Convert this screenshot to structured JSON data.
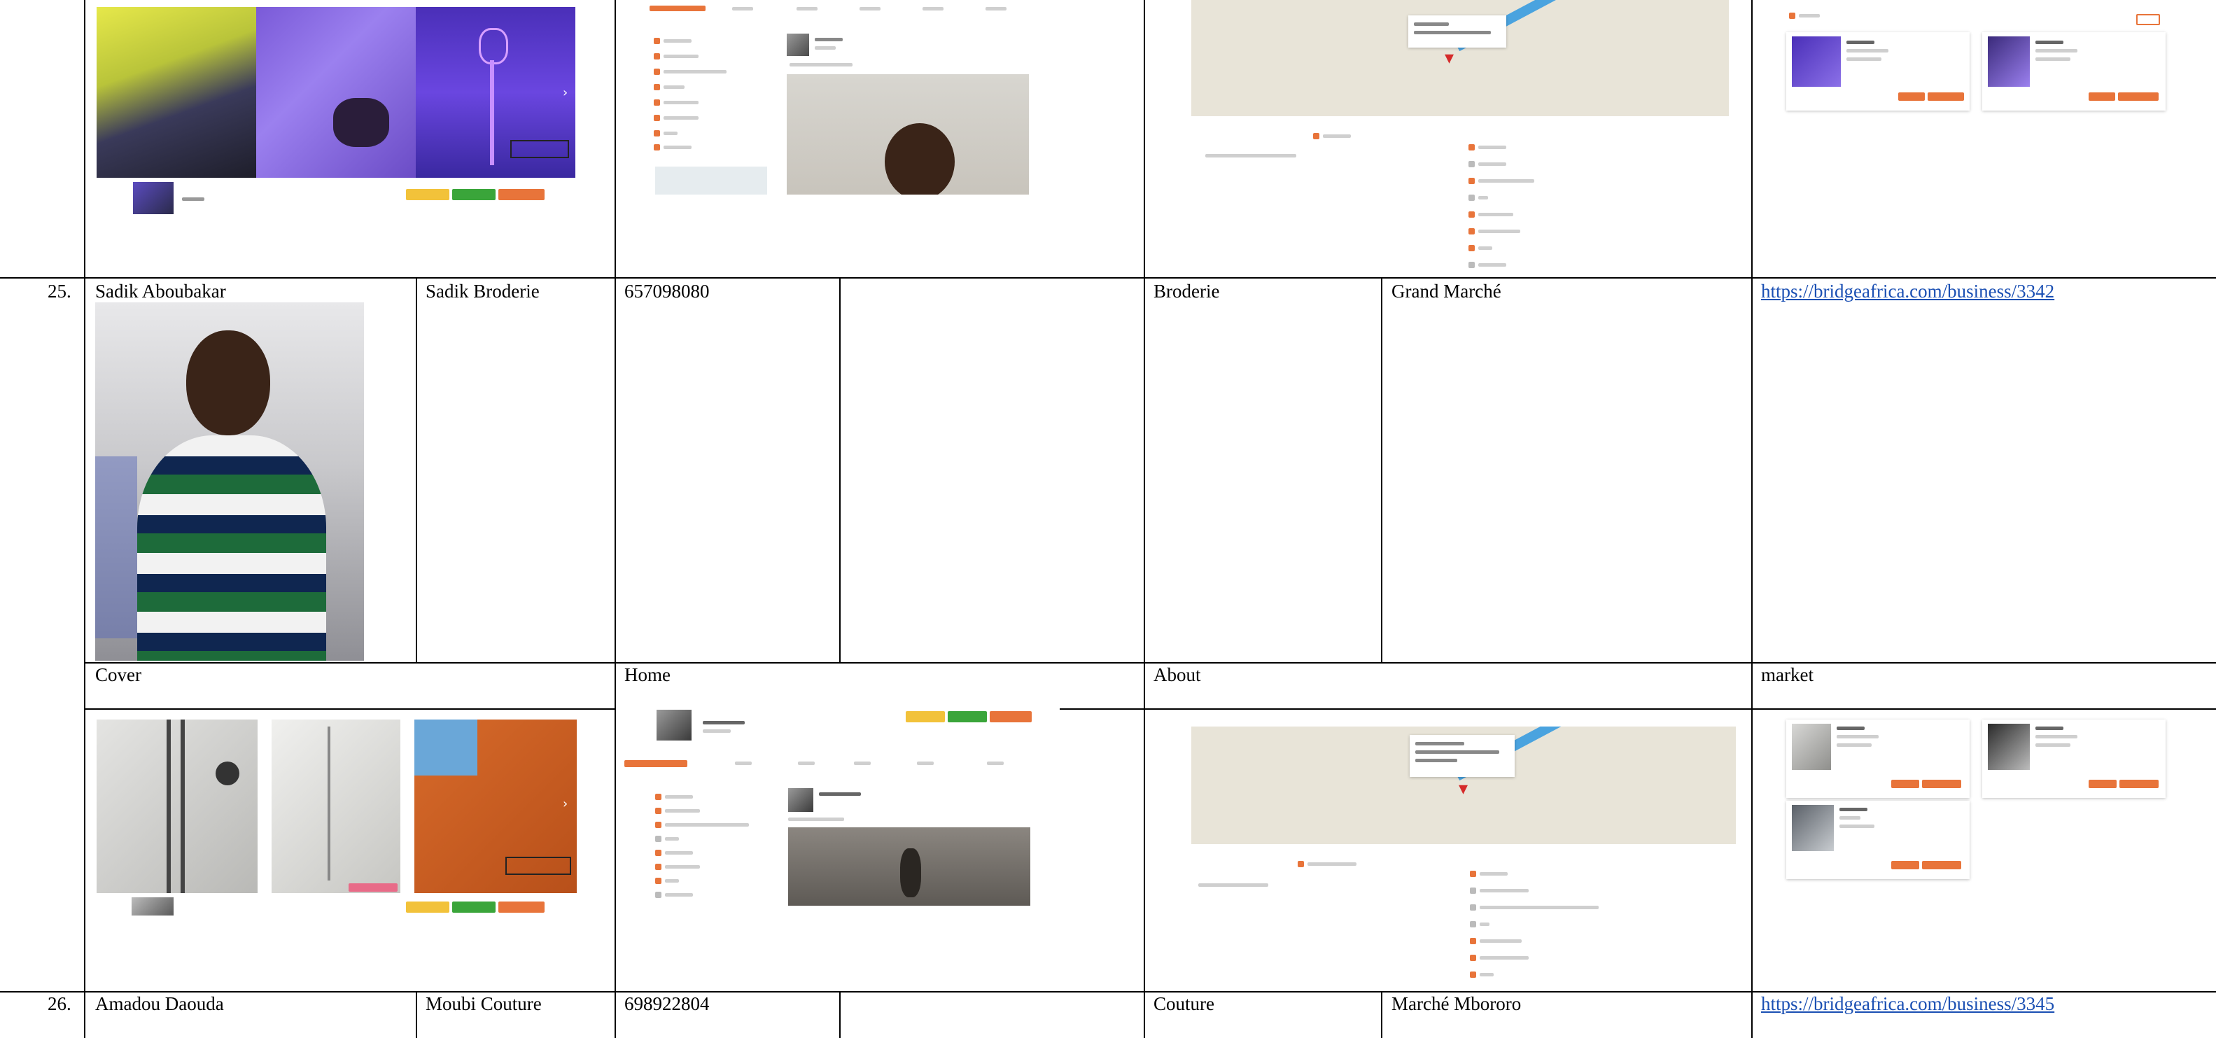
{
  "rows": [
    {
      "number": "25.",
      "name": "Sadik Aboubakar",
      "business": "Sadik Broderie",
      "phone": "657098080",
      "category": "Broderie",
      "market": "Grand Marché",
      "link": "https://bridgeafrica.com/business/3342"
    },
    {
      "number": "26.",
      "name": "Amadou Daouda",
      "business": "Moubi Couture",
      "phone": "698922804",
      "category": "Couture",
      "market": "Marché Mbororo",
      "link": "https://bridgeafrica.com/business/3345"
    }
  ],
  "screenshot_labels": {
    "cover": "Cover",
    "home": "Home",
    "about": "About",
    "market": "market"
  },
  "icons": [
    "map-pin-icon",
    "carousel-arrow-icon",
    "photo-icon"
  ],
  "colors": {
    "link": "#1a4fb3",
    "brand_orange": "#e8743a",
    "brand_green": "#3aa53a",
    "brand_yellow": "#f2c23a",
    "map_water": "#4aa3df"
  }
}
